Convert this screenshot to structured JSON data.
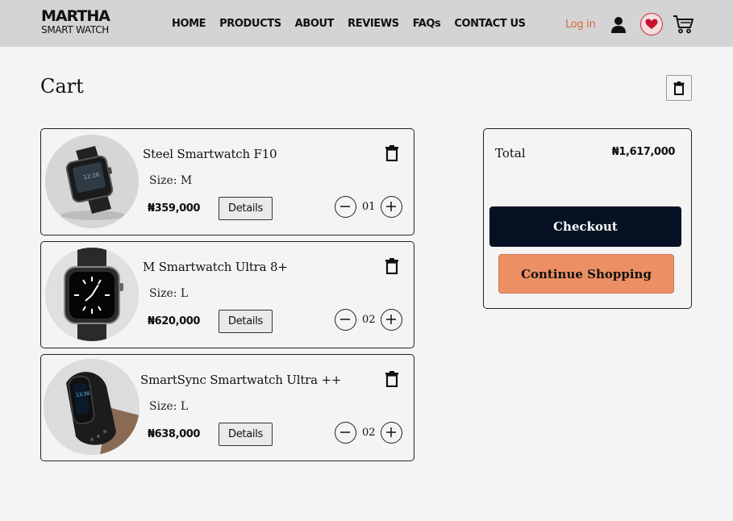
{
  "brand": {
    "line1": "MARTHA",
    "line2": "SMART WATCH"
  },
  "nav": {
    "links": [
      "HOME",
      "PRODUCTS",
      "ABOUT",
      "REVIEWS",
      "FAQs",
      "CONTACT US"
    ],
    "login": "Log in",
    "icons": [
      "user-icon",
      "heart-icon",
      "cart-icon"
    ]
  },
  "cart": {
    "title": "Cart",
    "items": [
      {
        "name": "Steel Smartwatch F10",
        "size": "Size: M",
        "price": "₦359,000",
        "details": "Details",
        "qty": "01"
      },
      {
        "name": "M Smartwatch Ultra 8+",
        "size": "Size: L",
        "price": "₦620,000",
        "details": "Details",
        "qty": "02"
      },
      {
        "name": "SmartSync Smartwatch Ultra ++",
        "size": "Size: L",
        "price": "₦638,000",
        "details": "Details",
        "qty": "02"
      }
    ]
  },
  "summary": {
    "total_label": "Total",
    "total_value": "₦1,617,000",
    "checkout": "Checkout",
    "continue": "Continue Shopping"
  },
  "colors": {
    "navbar": "#d4d4d4",
    "accent": "#d16a3a",
    "checkout_bg": "#061223",
    "continue_bg": "#ed8f65"
  }
}
